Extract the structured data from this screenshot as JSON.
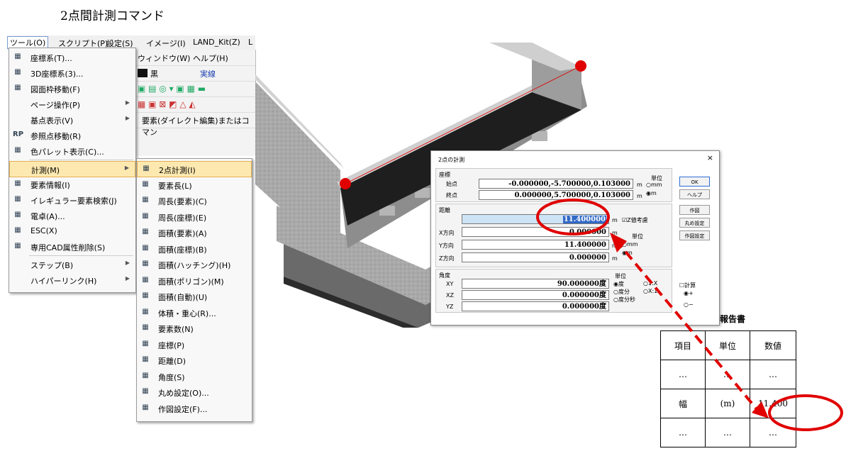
{
  "heading": "2点間計測コマンド",
  "menubar": [
    "ツール(O)",
    "スクリプト(P)",
    "設定(S)",
    "イメージ(I)",
    "LAND_Kit(Z)",
    "L"
  ],
  "bg_app": {
    "row1": "ウィンドウ(W)  ヘルプ(H)",
    "color": "黒",
    "linetype": "実線",
    "status": "要素(ダイレクト編集)またはコマン"
  },
  "tools_menu": [
    {
      "icon": "coordinate-system-icon",
      "label": "座標系(T)..."
    },
    {
      "icon": "3d-coordinate-icon",
      "label": "3D座標系(3)..."
    },
    {
      "icon": "frame-move-icon",
      "label": "図面枠移動(F)"
    },
    {
      "icon": "",
      "label": "ページ操作(P)",
      "submenu": true
    },
    {
      "icon": "",
      "label": "基点表示(V)",
      "submenu": true
    },
    {
      "icon": "rp-icon",
      "label": "参照点移動(R)"
    },
    {
      "icon": "palette-icon",
      "label": "色パレット表示(C)..."
    },
    {
      "icon": "",
      "label": "計測(M)",
      "submenu": true,
      "highlighted": true
    },
    {
      "icon": "element-info-icon",
      "label": "要素情報(I)"
    },
    {
      "icon": "irregular-search-icon",
      "label": "イレギュラー要素検索(J)"
    },
    {
      "icon": "calculator-icon",
      "label": "電卓(A)..."
    },
    {
      "icon": "esc-icon",
      "label": "ESC(X)"
    },
    {
      "icon": "cad-attr-icon",
      "label": "専用CAD属性削除(S)"
    },
    {
      "icon": "",
      "label": "ステップ(B)",
      "submenu": true
    },
    {
      "icon": "",
      "label": "ハイパーリンク(H)",
      "submenu": true
    }
  ],
  "measure_menu": [
    {
      "icon": "ruler-icon",
      "label": "2点計測(I)",
      "highlighted": true
    },
    {
      "icon": "element-length-icon",
      "label": "要素長(L)"
    },
    {
      "icon": "perimeter-element-icon",
      "label": "周長(要素)(C)"
    },
    {
      "icon": "perimeter-coord-icon",
      "label": "周長(座標)(E)"
    },
    {
      "icon": "area-element-icon",
      "label": "面積(要素)(A)"
    },
    {
      "icon": "area-coord-icon",
      "label": "面積(座標)(B)"
    },
    {
      "icon": "area-hatch-icon",
      "label": "面積(ハッチング)(H)"
    },
    {
      "icon": "area-polygon-icon",
      "label": "面積(ポリゴン)(M)"
    },
    {
      "icon": "area-auto-icon",
      "label": "面積(自動)(U)"
    },
    {
      "icon": "volume-icon",
      "label": "体積・重心(R)..."
    },
    {
      "icon": "element-count-icon",
      "label": "要素数(N)"
    },
    {
      "icon": "coordinate-icon",
      "label": "座標(P)"
    },
    {
      "icon": "distance-icon",
      "label": "距離(D)"
    },
    {
      "icon": "angle-icon",
      "label": "角度(S)"
    },
    {
      "icon": "rounding-icon",
      "label": "丸め設定(O)..."
    },
    {
      "icon": "drawing-settings-icon",
      "label": "作図設定(F)..."
    }
  ],
  "dialog": {
    "title": "2点の計測",
    "close": "×",
    "coord_group": "座標",
    "start_label": "始点",
    "start_value": "-0.000000,-5.700000,0.103000",
    "end_label": "終点",
    "end_value": "0.000000,5.700000,0.103000",
    "unit_m": "m",
    "unit_group": "単位",
    "unit_opt_mm": "mm",
    "unit_opt_m": "m",
    "distance_group": "距離",
    "distance_value": "11.400000",
    "z_consider": "Z値考慮",
    "x_label": "X方向",
    "x_value": "0.000000",
    "y_label": "Y方向",
    "y_value": "11.400000",
    "z_label": "Z方向",
    "z_value": "0.000000",
    "dist_unit_group": "単位",
    "dist_unit_mm": "mm",
    "dist_unit_m": "m",
    "angle_group": "角度",
    "xy_label": "XY",
    "xy_value": "90.000000度",
    "xz_label": "XZ",
    "xz_value": "0.000000度",
    "yz_label": "YZ",
    "yz_value": "0.000000度",
    "angle_unit_group": "単位",
    "angle_opt_deg": "度",
    "angle_opt_degmin": "度分",
    "angle_opt_degminsec": "度分秒",
    "angle_opt_1x": "1:X",
    "angle_opt_x1": "X:1",
    "calc_label": "計算",
    "calc_plus": "+",
    "calc_minus": "−",
    "buttons": {
      "ok": "OK",
      "help": "ヘルプ",
      "draw": "作図",
      "round": "丸め設定",
      "draw_settings": "作図設定"
    }
  },
  "report": {
    "title": "報告書",
    "headers": [
      "項目",
      "単位",
      "数値"
    ],
    "rows": [
      [
        "…",
        "…",
        "…"
      ],
      [
        "幅",
        "(m)",
        "11.400"
      ],
      [
        "…",
        "…",
        "…"
      ]
    ]
  },
  "colors": {
    "annotation_red": "#e00000",
    "menu_highlight": "#fde9b0",
    "selection_blue": "#3169c6"
  }
}
